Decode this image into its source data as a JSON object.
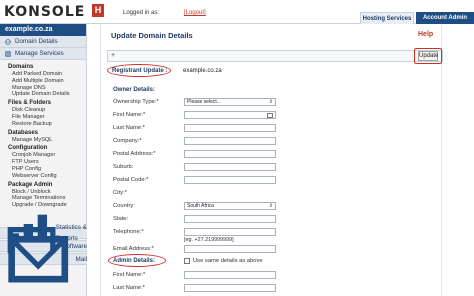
{
  "topbar": {
    "logo_text": "KONSOLE",
    "logo_badge": "H",
    "logged_in_label": "Logged in as:",
    "logout_label": "[Logout]",
    "tabs": [
      {
        "label": "Hosting Services",
        "active": true
      },
      {
        "label": "Account Admin",
        "active": false
      }
    ]
  },
  "sidebar": {
    "domain": "example.co.za",
    "nav_domain_details": "Domain Details",
    "nav_manage_services": "Manage Services",
    "sections": [
      {
        "title": "Domains",
        "items": [
          "Add Parked Domain",
          "Add Multiple Domain",
          "Manage DNS",
          "Update Domain Details"
        ]
      },
      {
        "title": "Files & Folders",
        "items": [
          "Disk Cleanup",
          "File Manager",
          "Restore Backup"
        ]
      },
      {
        "title": "Databases",
        "items": [
          "Manage MySQL"
        ]
      },
      {
        "title": "Configuration",
        "items": [
          "Cronjob Manager",
          "FTP Users",
          "PHP Config",
          "Webserver Config"
        ]
      },
      {
        "title": "Package Admin",
        "items": [
          "Block / Unblock",
          "Manage Terminations",
          "Upgrade / Downgrade"
        ]
      }
    ],
    "bottom_nav": [
      "Statistics & Reports",
      "Software",
      "Mail"
    ]
  },
  "main": {
    "title": "Update Domain Details",
    "help_label": "Help",
    "toolbar_plus": "+",
    "update_button": "Update",
    "registrant_label": "Registrant Update :",
    "registrant_domain": "example.co.za",
    "owner_details_title": "Owner Details:",
    "owner_fields": [
      {
        "label": "Ownership Type:*",
        "type": "select",
        "value": "Please select..."
      },
      {
        "label": "First Name:*",
        "type": "input",
        "value": ""
      },
      {
        "label": "Last Name:*",
        "type": "input",
        "value": ""
      },
      {
        "label": "Company:*",
        "type": "input",
        "value": ""
      },
      {
        "label": "Postal Address:*",
        "type": "input",
        "value": ""
      },
      {
        "label": "Suburb:",
        "type": "input",
        "value": ""
      },
      {
        "label": "Postal Code:*",
        "type": "input",
        "value": ""
      },
      {
        "label": "City:*",
        "type": "none",
        "value": ""
      },
      {
        "label": "Country:",
        "type": "select",
        "value": "South Africa"
      },
      {
        "label": "State:",
        "type": "input",
        "value": ""
      },
      {
        "label": "Telephone:*",
        "type": "input",
        "value": ""
      },
      {
        "label": "",
        "type": "hint",
        "value": "[eg. +27.219999999]"
      },
      {
        "label": "Email Address:*",
        "type": "input",
        "value": ""
      }
    ],
    "admin_details_title": "Admin Details:",
    "same_details_label": "Use same details as above",
    "admin_fields": [
      "First Name:*",
      "Last Name:*"
    ]
  },
  "colors": {
    "accent_blue": "#1f4e85",
    "highlight_red": "#d42b2b",
    "logo_red": "#c0392b"
  }
}
